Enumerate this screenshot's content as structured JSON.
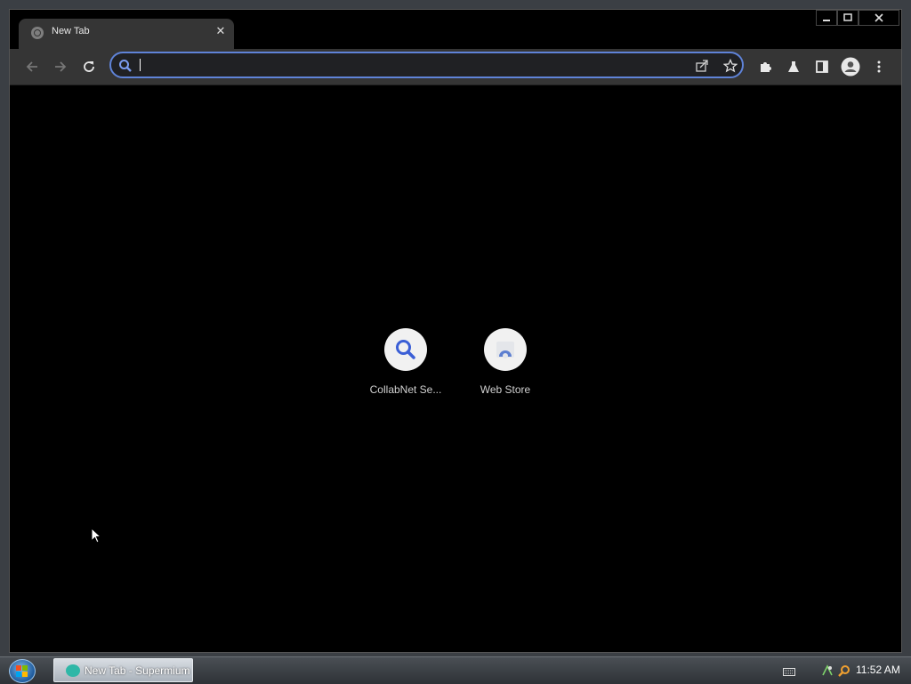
{
  "window": {
    "tab_title": "New Tab"
  },
  "toolbar": {
    "omnibox_value": ""
  },
  "shortcuts": [
    {
      "label": "CollabNet Se...",
      "icon": "search-icon"
    },
    {
      "label": "Web Store",
      "icon": "web-store-icon"
    }
  ],
  "taskbar": {
    "task_label": "New Tab - Supermium",
    "clock": "11:52 AM"
  },
  "colors": {
    "page_background": "#000000",
    "toolbar": "#353535",
    "omnibox_focus_border": "#5f83d8",
    "accent_blue": "#3b5fd6"
  }
}
